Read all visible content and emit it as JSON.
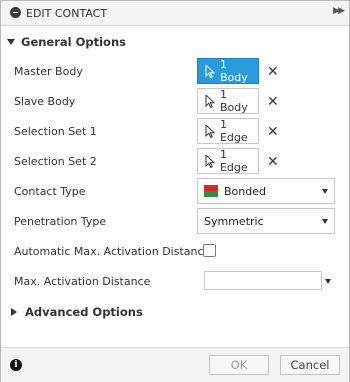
{
  "titlebar": {
    "title": "EDIT CONTACT"
  },
  "general": {
    "heading": "General Options",
    "master_body": {
      "label": "Master Body",
      "value": "1 Body"
    },
    "slave_body": {
      "label": "Slave Body",
      "value": "1 Body"
    },
    "selection_set_1": {
      "label": "Selection Set 1",
      "value": "1 Edge"
    },
    "selection_set_2": {
      "label": "Selection Set 2",
      "value": "1 Edge"
    },
    "contact_type": {
      "label": "Contact Type",
      "value": "Bonded"
    },
    "penetration_type": {
      "label": "Penetration Type",
      "value": "Symmetric"
    },
    "auto_activation": {
      "label": "Automatic Max. Activation Distance",
      "checked": false
    },
    "max_activation": {
      "label": "Max. Activation Distance",
      "value": ""
    }
  },
  "advanced": {
    "heading": "Advanced Options"
  },
  "footer": {
    "ok_label": "OK",
    "cancel_label": "Cancel"
  },
  "colors": {
    "active_selection": "#2a9bdc",
    "bonded_top": "#d8262b",
    "bonded_bottom": "#2f8f3a"
  }
}
